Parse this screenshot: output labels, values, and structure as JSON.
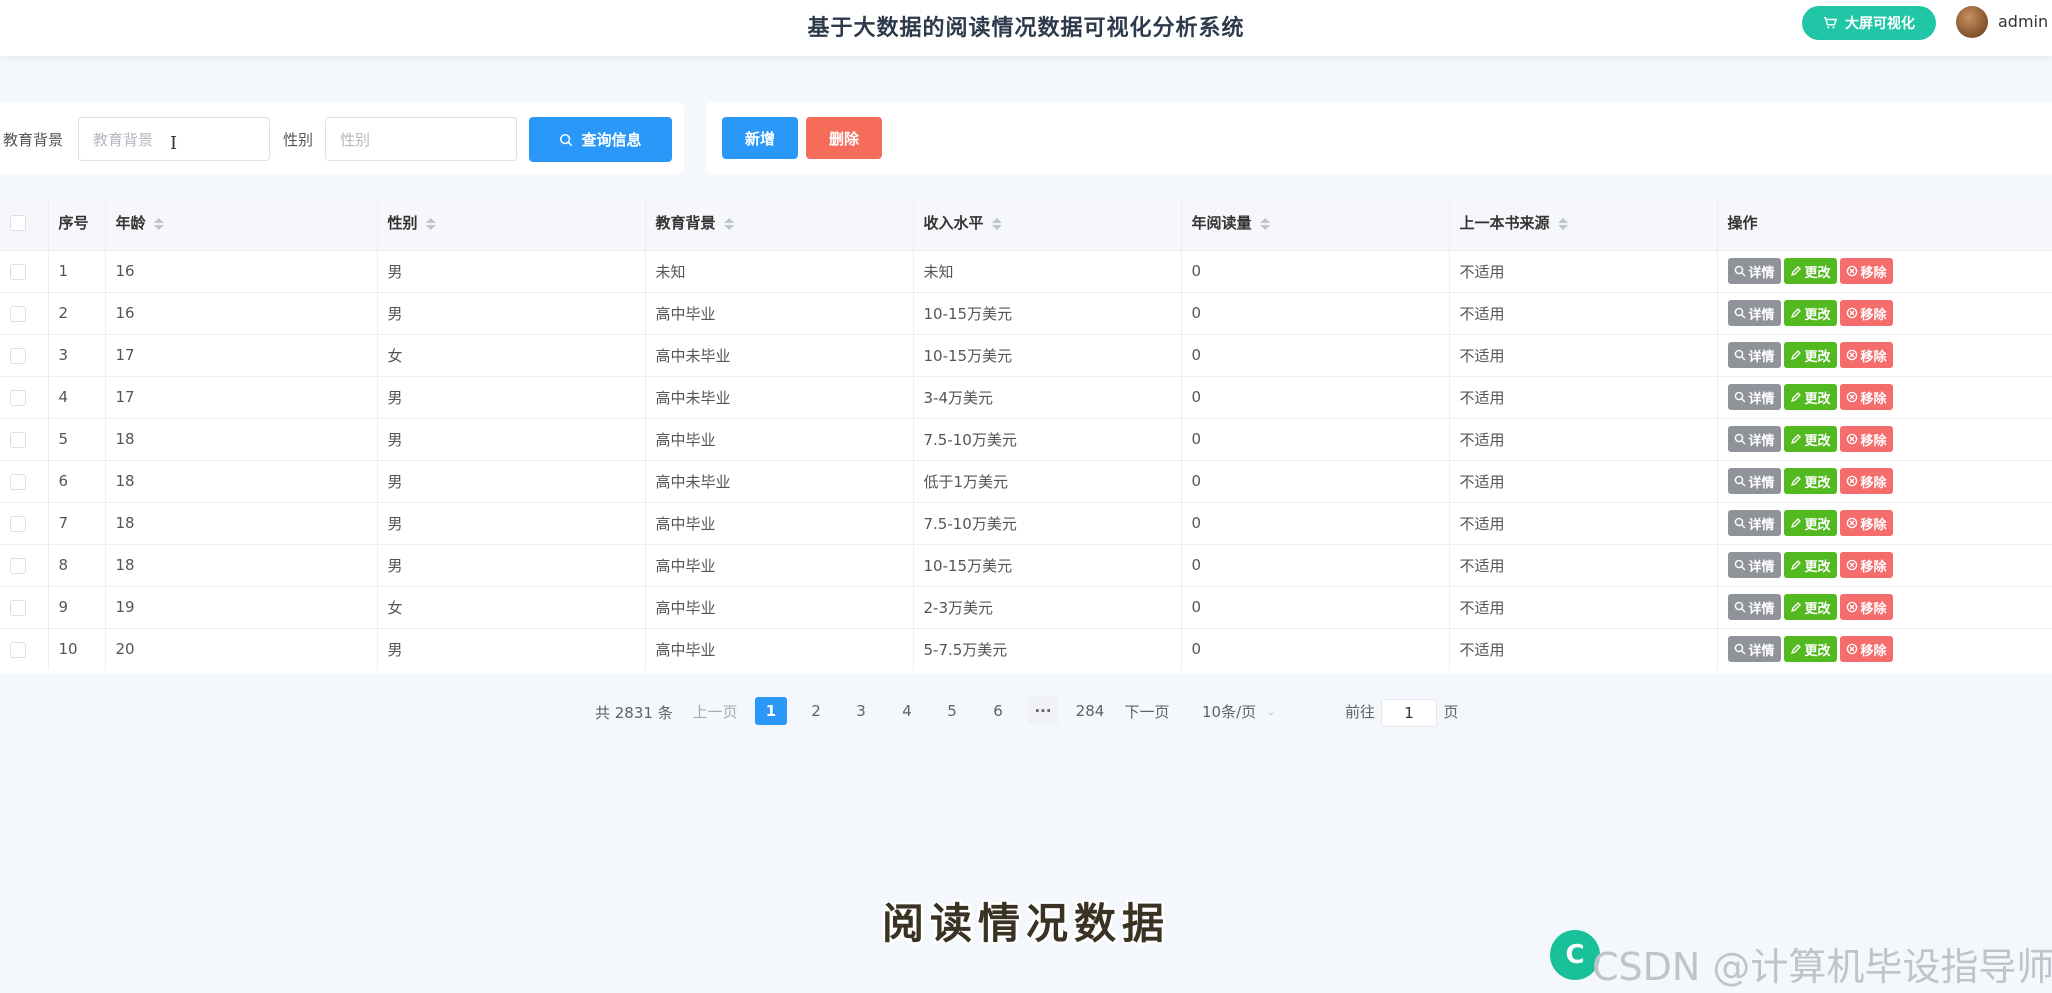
{
  "header": {
    "title": "基于大数据的阅读情况数据可视化分析系统",
    "bigscreen_label": "大屏可视化",
    "username": "admin"
  },
  "search": {
    "edu_label": "教育背景",
    "edu_placeholder": "教育背景",
    "gender_label": "性别",
    "gender_placeholder": "性别",
    "query_label": "查询信息"
  },
  "actions": {
    "add_label": "新增",
    "delete_label": "删除"
  },
  "table": {
    "columns": [
      "序号",
      "年龄",
      "性别",
      "教育背景",
      "收入水平",
      "年阅读量",
      "上一本书来源",
      "操作"
    ],
    "op_labels": {
      "detail": "详情",
      "edit": "更改",
      "remove": "移除"
    },
    "rows": [
      {
        "idx": "1",
        "age": "16",
        "gender": "男",
        "edu": "未知",
        "income": "未知",
        "reads": "0",
        "source": "不适用"
      },
      {
        "idx": "2",
        "age": "16",
        "gender": "男",
        "edu": "高中毕业",
        "income": "10-15万美元",
        "reads": "0",
        "source": "不适用"
      },
      {
        "idx": "3",
        "age": "17",
        "gender": "女",
        "edu": "高中未毕业",
        "income": "10-15万美元",
        "reads": "0",
        "source": "不适用"
      },
      {
        "idx": "4",
        "age": "17",
        "gender": "男",
        "edu": "高中未毕业",
        "income": "3-4万美元",
        "reads": "0",
        "source": "不适用"
      },
      {
        "idx": "5",
        "age": "18",
        "gender": "男",
        "edu": "高中毕业",
        "income": "7.5-10万美元",
        "reads": "0",
        "source": "不适用"
      },
      {
        "idx": "6",
        "age": "18",
        "gender": "男",
        "edu": "高中未毕业",
        "income": "低于1万美元",
        "reads": "0",
        "source": "不适用"
      },
      {
        "idx": "7",
        "age": "18",
        "gender": "男",
        "edu": "高中毕业",
        "income": "7.5-10万美元",
        "reads": "0",
        "source": "不适用"
      },
      {
        "idx": "8",
        "age": "18",
        "gender": "男",
        "edu": "高中毕业",
        "income": "10-15万美元",
        "reads": "0",
        "source": "不适用"
      },
      {
        "idx": "9",
        "age": "19",
        "gender": "女",
        "edu": "高中毕业",
        "income": "2-3万美元",
        "reads": "0",
        "source": "不适用"
      },
      {
        "idx": "10",
        "age": "20",
        "gender": "男",
        "edu": "高中毕业",
        "income": "5-7.5万美元",
        "reads": "0",
        "source": "不适用"
      }
    ]
  },
  "pagination": {
    "total_text": "共 2831 条",
    "prev_label": "上一页",
    "pages": [
      "1",
      "2",
      "3",
      "4",
      "5",
      "6"
    ],
    "ellipsis": "···",
    "last_page": "284",
    "next_label": "下一页",
    "page_size": "10条/页",
    "goto_label": "前往",
    "goto_value": "1",
    "goto_unit": "页"
  },
  "overlay": {
    "subtitle": "阅读情况数据",
    "watermark": "CSDN @计算机毕设指导师"
  }
}
